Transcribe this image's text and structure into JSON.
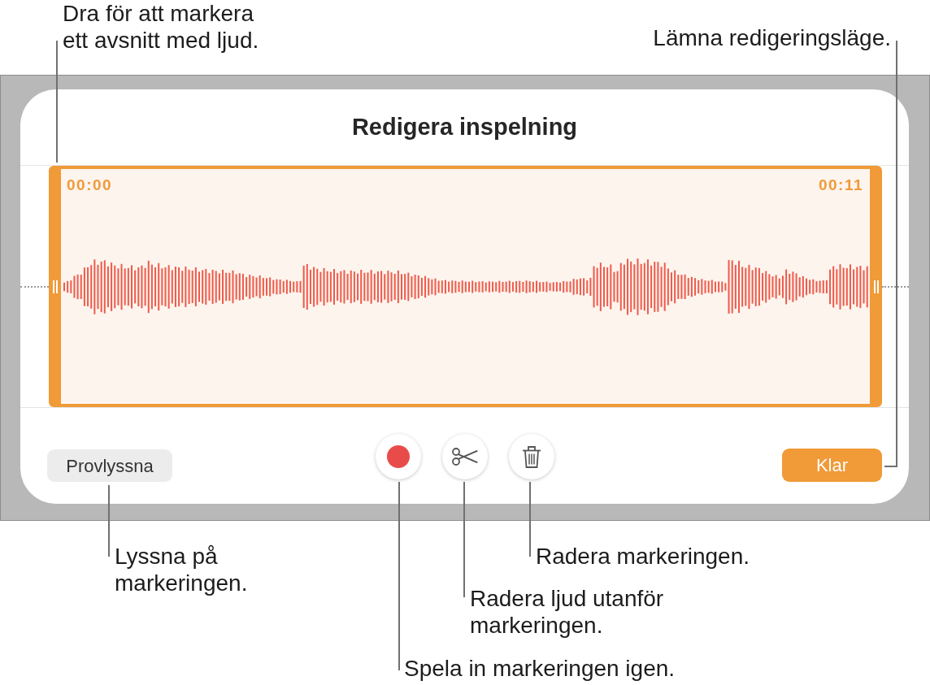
{
  "dialog": {
    "title": "Redigera inspelning",
    "recording": {
      "start_time": "00:00",
      "end_time": "00:11"
    },
    "buttons": [
      {
        "kind": "text",
        "label": "Provlyssna"
      },
      {
        "kind": "record"
      },
      {
        "kind": "trim"
      },
      {
        "kind": "delete"
      },
      {
        "kind": "primary",
        "label": "Klar"
      }
    ]
  },
  "callouts": [
    {
      "text": "Dra för att markera\nett avsnitt med ljud."
    },
    {
      "text": "Lämna redigeringsläge."
    },
    {
      "text": "Lyssna på\nmarkeringen."
    },
    {
      "text": "Radera markeringen."
    },
    {
      "text": "Radera ljud utanför\nmarkeringen."
    },
    {
      "text": "Spela in markeringen igen."
    }
  ]
}
